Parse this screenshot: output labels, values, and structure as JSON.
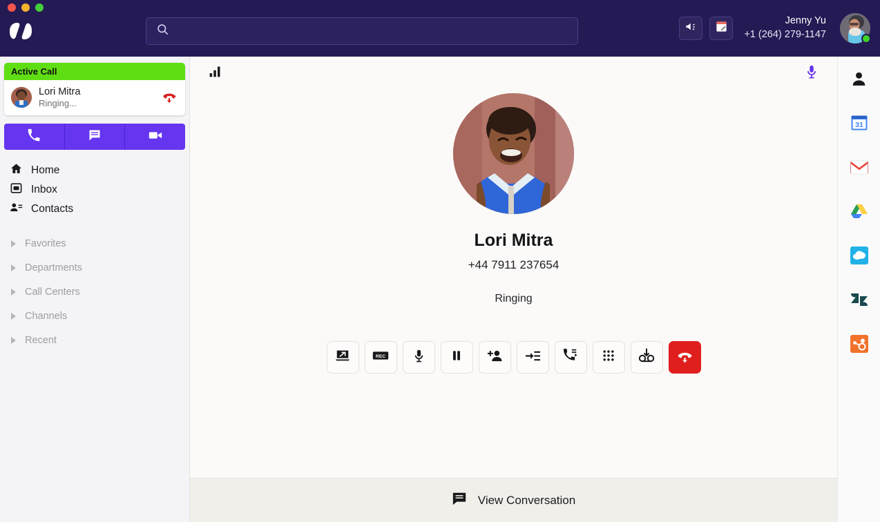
{
  "window": {
    "traffic_lights": [
      "close",
      "minimize",
      "maximize"
    ],
    "colors": {
      "header_bg": "#241A54",
      "accent_purple": "#6635F0",
      "active_green": "#5FDE14",
      "end_call_red": "#E01E1E",
      "sidebar_bg": "#F4F4F7",
      "main_bg": "#FBFAF8",
      "bottom_bar_bg": "#F0EFEA"
    }
  },
  "header": {
    "logo_name": "dialpad-logo",
    "search": {
      "value": "",
      "placeholder": ""
    },
    "announcement_icon": "megaphone-icon",
    "notes_icon": "notepad-icon",
    "user": {
      "name": "Jenny Yu",
      "phone": "+1 (264) 279-1147",
      "avatar_icon": "user-avatar",
      "presence": "available"
    }
  },
  "sidebar": {
    "active_call": {
      "header_label": "Active Call",
      "contact_name": "Lori Mitra",
      "status": "Ringing...",
      "hangup_icon": "hangup-icon",
      "avatar_icon": "contact-avatar"
    },
    "quick_actions": [
      {
        "name": "new-call",
        "icon": "phone-icon"
      },
      {
        "name": "new-message",
        "icon": "chat-icon"
      },
      {
        "name": "new-video",
        "icon": "video-camera-icon"
      }
    ],
    "nav_items": [
      {
        "label": "Home",
        "icon": "home-icon"
      },
      {
        "label": "Inbox",
        "icon": "inbox-icon"
      },
      {
        "label": "Contacts",
        "icon": "contacts-icon"
      }
    ],
    "groups": [
      {
        "label": "Favorites"
      },
      {
        "label": "Departments"
      },
      {
        "label": "Call Centers"
      },
      {
        "label": "Channels"
      },
      {
        "label": "Recent"
      }
    ]
  },
  "main": {
    "signal_icon": "signal-bars-icon",
    "mic_icon": "microphone-icon",
    "callee": {
      "name": "Lori Mitra",
      "number": "+44 7911 237654",
      "status": "Ringing",
      "photo": "contact-photo"
    },
    "controls": [
      {
        "name": "screen-share-button",
        "icon": "screen-share-icon"
      },
      {
        "name": "record-button",
        "icon": "rec-icon"
      },
      {
        "name": "mute-button",
        "icon": "microphone-icon"
      },
      {
        "name": "hold-button",
        "icon": "pause-icon"
      },
      {
        "name": "add-participant-button",
        "icon": "add-person-icon"
      },
      {
        "name": "transfer-button",
        "icon": "transfer-icon"
      },
      {
        "name": "park-call-button",
        "icon": "phone-forward-icon"
      },
      {
        "name": "keypad-button",
        "icon": "dialpad-grid-icon"
      },
      {
        "name": "voicemail-button",
        "icon": "voicemail-icon"
      },
      {
        "name": "end-call-button",
        "icon": "end-call-icon"
      }
    ],
    "bottom_bar": {
      "label": "View Conversation",
      "icon": "chat-icon"
    }
  },
  "right_rail": [
    {
      "name": "rail-contact",
      "icon": "person-icon"
    },
    {
      "name": "rail-google-calendar",
      "icon": "google-calendar-icon",
      "badge": "31"
    },
    {
      "name": "rail-gmail",
      "icon": "gmail-icon"
    },
    {
      "name": "rail-google-drive",
      "icon": "google-drive-icon"
    },
    {
      "name": "rail-salesforce",
      "icon": "salesforce-icon"
    },
    {
      "name": "rail-zendesk",
      "icon": "zendesk-icon"
    },
    {
      "name": "rail-hubspot",
      "icon": "hubspot-icon"
    }
  ]
}
